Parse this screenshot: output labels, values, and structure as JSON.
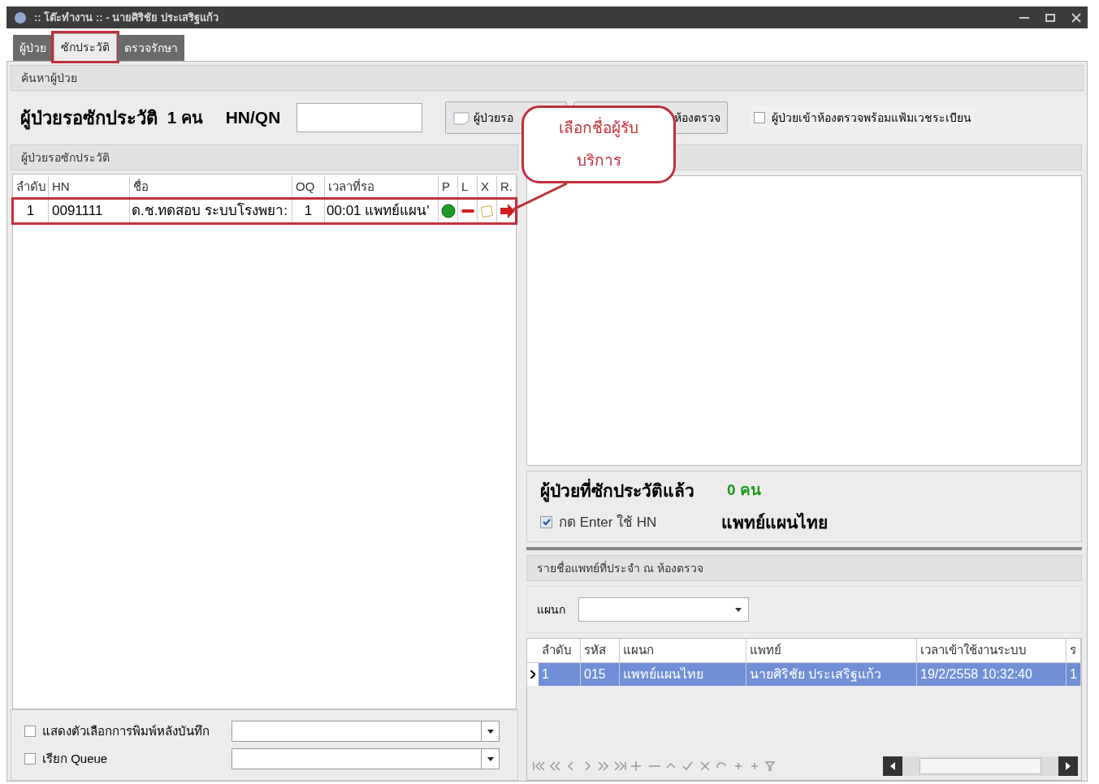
{
  "window": {
    "title": ":: โต๊ะทำงาน :: - นายศิริชัย ประเสริฐแก้ว"
  },
  "tabs": [
    {
      "label": "ผู้ป่วย",
      "selected": false,
      "annotated": false
    },
    {
      "label": "ซักประวัติ",
      "selected": true,
      "annotated": true
    },
    {
      "label": "ตรวจรักษา",
      "selected": false,
      "annotated": false
    }
  ],
  "search_section": {
    "title": "ค้นหาผู้ป่วย",
    "waiting_label": "ผู้ป่วยรอซักประวัติ",
    "waiting_count": "1 คน",
    "hn_label": "HN/QN",
    "buttons": [
      "ผู้ป่วยรอ",
      "ห้องตรวจ"
    ],
    "with_record_checkbox": {
      "label": "ผู้ป่วยเข้าห้องตรวจพร้อมแฟ้มเวชระเบียน",
      "checked": false
    }
  },
  "callout": {
    "text": "เลือกชื่อผู้รับบริการ"
  },
  "waiting_list": {
    "title": "ผู้ป่วยรอซักประวัติ",
    "columns": [
      "ลำดับ",
      "HN",
      "ชื่อ",
      "OQ",
      "เวลาที่รอ",
      "P",
      "L",
      "X",
      "R."
    ],
    "rows": [
      {
        "cells": [
          "1",
          "0091111",
          "ด.ช.ทดสอบ  ระบบโรงพยา:",
          "1",
          "00:01 แพทย์แผน'"
        ],
        "annotated": true
      }
    ]
  },
  "options": [
    {
      "label": "แสดงตัวเลือกการพิมพ์หลังบันทึก",
      "checked": false
    },
    {
      "label": "เรียก Queue",
      "checked": false
    }
  ],
  "done_section": {
    "label": "ผู้ป่วยที่ซักประวัติแล้ว",
    "count": "0 คน",
    "enter_checkbox": {
      "label": "กด Enter ใช้ HN",
      "checked": true
    },
    "department": "แพทย์แผนไทย"
  },
  "doctor_list": {
    "title": "รายชื่อแพทย์ที่ประจำ ณ ห้องตรวจ",
    "department_label": "แผนก",
    "columns": [
      "ลำดับ",
      "รหัส",
      "แผนก",
      "แพทย์",
      "เวลาเข้าใช้งานระบบ",
      "ร"
    ],
    "rows": [
      {
        "cells": [
          "1",
          "015",
          "แพทย์แผนไทย",
          "นายศิริชัย ประเสริฐแก้ว",
          "19/2/2558 10:32:40",
          "1"
        ],
        "selected": true
      }
    ]
  }
}
